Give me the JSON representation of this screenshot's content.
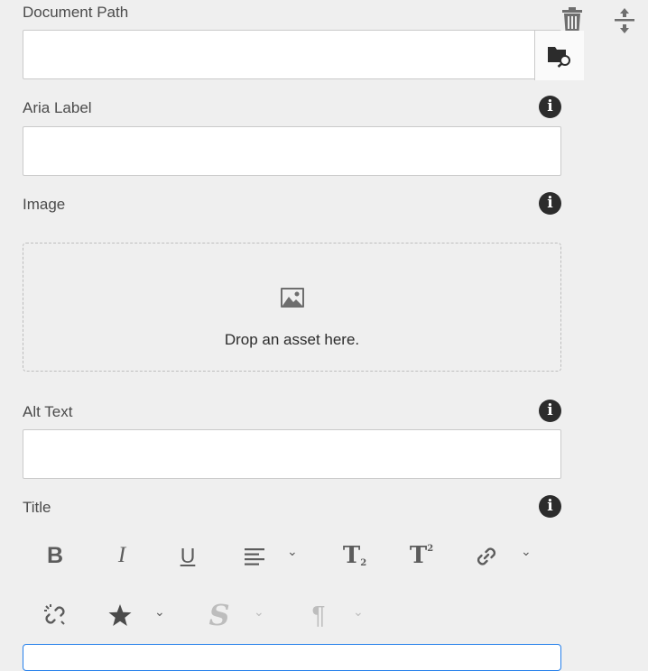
{
  "document_path": {
    "label": "Document Path",
    "value": ""
  },
  "aria_label": {
    "label": "Aria Label",
    "value": ""
  },
  "image": {
    "label": "Image",
    "drop_text": "Drop an asset here."
  },
  "alt_text": {
    "label": "Alt Text",
    "value": ""
  },
  "title": {
    "label": "Title"
  },
  "info_glyph": "i",
  "toolbar": {
    "bold": "B",
    "italic": "I",
    "underline": "U",
    "subscript": "T",
    "subscript_mark": "2",
    "superscript": "T",
    "superscript_mark": "2",
    "strikethrough": "S",
    "paragraph": "¶",
    "dropdown": "⌄"
  },
  "icons": {
    "delete": "trash-icon",
    "reorder": "drag-handle-icon",
    "browse": "folder-search-icon",
    "image": "image-icon",
    "link": "link-icon",
    "unlink": "unlink-icon",
    "align": "align-left-icon",
    "special_chars": "star-icon"
  },
  "colors": {
    "accent": "#2680eb",
    "info": "#2c2c2c",
    "background": "#efefef"
  }
}
